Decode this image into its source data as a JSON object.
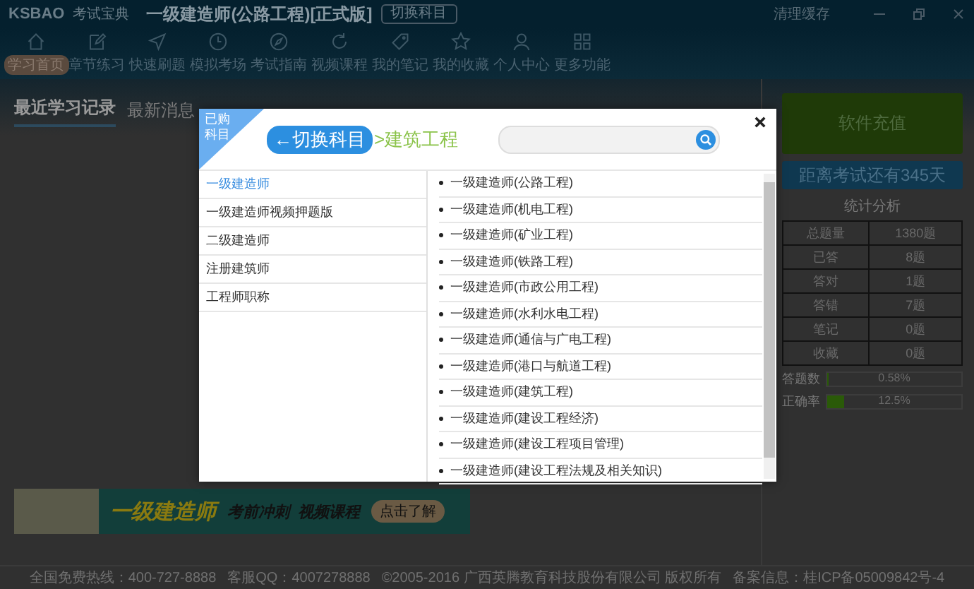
{
  "window": {
    "logo": "KSBAO",
    "brand": "考试宝典",
    "title": "一级建造师(公路工程)[正式版]",
    "switch_button": "切换科目",
    "cache_button": "清理缓存"
  },
  "nav": [
    {
      "label": "学习首页",
      "selected": true
    },
    {
      "label": "章节练习",
      "selected": false
    },
    {
      "label": "快速刷题",
      "selected": false
    },
    {
      "label": "模拟考场",
      "selected": false
    },
    {
      "label": "考试指南",
      "selected": false
    },
    {
      "label": "视频课程",
      "selected": false
    },
    {
      "label": "我的笔记",
      "selected": false
    },
    {
      "label": "我的收藏",
      "selected": false
    },
    {
      "label": "个人中心",
      "selected": false
    },
    {
      "label": "更多功能",
      "selected": false
    }
  ],
  "tabs": [
    {
      "label": "最近学习记录",
      "selected": true
    },
    {
      "label": "最新消息",
      "selected": false
    }
  ],
  "banner": {
    "title": "一级建造师",
    "subtitle": "考前冲刺  视频课程",
    "button": "点击了解"
  },
  "side": {
    "recharge": "软件充值",
    "countdown": "距离考试还有345天",
    "stats_title": "统计分析",
    "stats": [
      [
        "总题量",
        "1380题"
      ],
      [
        "已答",
        "8题"
      ],
      [
        "答对",
        "1题"
      ],
      [
        "答错",
        "7题"
      ],
      [
        "笔记",
        "0题"
      ],
      [
        "收藏",
        "0题"
      ]
    ],
    "meters": [
      {
        "label": "答题数",
        "reading": "0.58%",
        "level": 0.0058
      },
      {
        "label": "正确率",
        "reading": "12.5%",
        "level": 0.125
      }
    ]
  },
  "footer": [
    "全国免费热线：400-727-8888",
    "客服QQ：4007278888",
    "©2005-2016 广西英腾教育科技股份有限公司 版权所有",
    "备案信息：桂ICP备05009842号-4"
  ],
  "dialog": {
    "corner": "已购科目",
    "back_button": "←切换科目",
    "breadcrumb": ">建筑工程",
    "categories": [
      {
        "label": "一级建造师",
        "selected": true
      },
      {
        "label": "一级建造师视频押题版",
        "selected": false
      },
      {
        "label": "二级建造师",
        "selected": false
      },
      {
        "label": "注册建筑师",
        "selected": false
      },
      {
        "label": "工程师职称",
        "selected": false
      }
    ],
    "subjects": [
      "一级建造师(公路工程)",
      "一级建造师(机电工程)",
      "一级建造师(矿业工程)",
      "一级建造师(铁路工程)",
      "一级建造师(市政公用工程)",
      "一级建造师(水利水电工程)",
      "一级建造师(通信与广电工程)",
      "一级建造师(港口与航道工程)",
      "一级建造师(建筑工程)",
      "一级建造师(建设工程经济)",
      "一级建造师(建设工程项目管理)",
      "一级建造师(建设工程法规及相关知识)"
    ]
  }
}
